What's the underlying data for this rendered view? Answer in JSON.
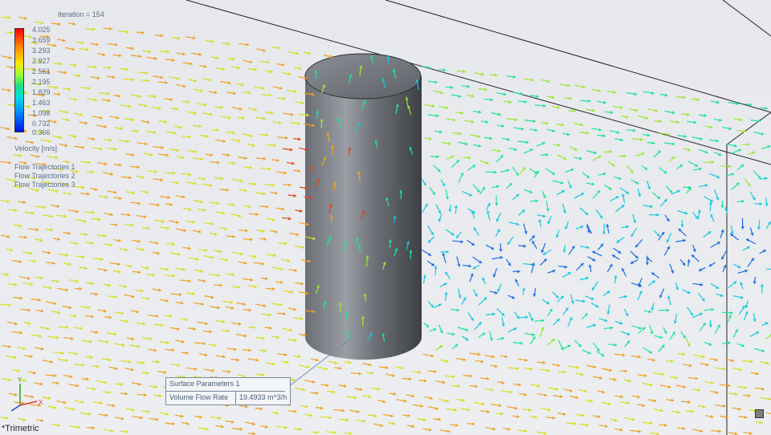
{
  "iteration": "Iteration = 154",
  "legend": {
    "ticks": [
      "4.025",
      "3.659",
      "3.293",
      "2.927",
      "2.561",
      "2.195",
      "1.829",
      "1.463",
      "1.098",
      "0.732",
      "0.366"
    ],
    "title": "Velocity [m/s]"
  },
  "trajectories": [
    "Flow Trajectories 1",
    "Flow Trajectories 2",
    "Flow Trajectories 3"
  ],
  "surface_params": {
    "title": "Surface Parameters 1",
    "label": "Volume Flow Rate",
    "value": "19.4933 m^3/h"
  },
  "view_name": "*Trimetric",
  "triad_labels": {
    "y": "Y",
    "x": "X"
  },
  "colors": {
    "cylinder": "#5f646b",
    "background": "#e9ebee",
    "accent": "#ff0000"
  }
}
